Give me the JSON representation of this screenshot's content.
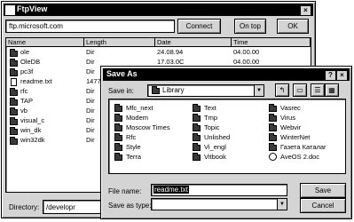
{
  "ftp": {
    "title": "FtpView",
    "close_glyph": "×",
    "address": "ftp.microsoft.com",
    "connect_label": "Connect",
    "ontop_label": "On top",
    "ok_label": "OK",
    "columns": [
      "Name",
      "Length",
      "Date",
      "Time"
    ],
    "rows": [
      {
        "name": "ole",
        "length": "Dir",
        "date": "24.08.94",
        "time": "04.00.00",
        "type": "folder"
      },
      {
        "name": "OleDB",
        "length": "Dir",
        "date": "17.03.0C",
        "time": "04.00.00",
        "type": "folder"
      },
      {
        "name": "pc3f",
        "length": "Dir",
        "date": "",
        "time": "",
        "type": "folder"
      },
      {
        "name": "readme.txt",
        "length": "1477",
        "date": "",
        "time": "",
        "type": "file"
      },
      {
        "name": "rfc",
        "length": "Dir",
        "date": "",
        "time": "",
        "type": "folder"
      },
      {
        "name": "TAP",
        "length": "Dir",
        "date": "",
        "time": "",
        "type": "folder"
      },
      {
        "name": "vb",
        "length": "Dir",
        "date": "",
        "time": "",
        "type": "folder"
      },
      {
        "name": "visual_c",
        "length": "Dir",
        "date": "",
        "time": "",
        "type": "folder"
      },
      {
        "name": "win_dk",
        "length": "Dir",
        "date": "",
        "time": "",
        "type": "folder"
      },
      {
        "name": "win32dk",
        "length": "Dir",
        "date": "",
        "time": "",
        "type": "folder"
      }
    ],
    "directory_label": "Directory:",
    "directory_value": "/developr"
  },
  "saveas": {
    "title": "Save As",
    "help_glyph": "?",
    "close_glyph": "×",
    "savein_label": "Save in:",
    "savein_value": "Library",
    "items_col1": [
      "Mfc_next",
      "Modem",
      "Moscow Times",
      "Rfc",
      "Style",
      "Terra"
    ],
    "items_col2": [
      "Text",
      "Tmp",
      "Topic",
      "Unlished",
      "Vi_engl",
      "Vitbook"
    ],
    "items_col3": [
      "Vasrec",
      "Virus",
      "Webvir",
      "WinterNet",
      "Газета Каталаг",
      "AveOS 2.doc"
    ],
    "filename_label": "File name:",
    "filename_value": "readme.txt",
    "savetype_label": "Save as type:",
    "savetype_value": "",
    "save_label": "Save",
    "cancel_label": "Cancel"
  }
}
